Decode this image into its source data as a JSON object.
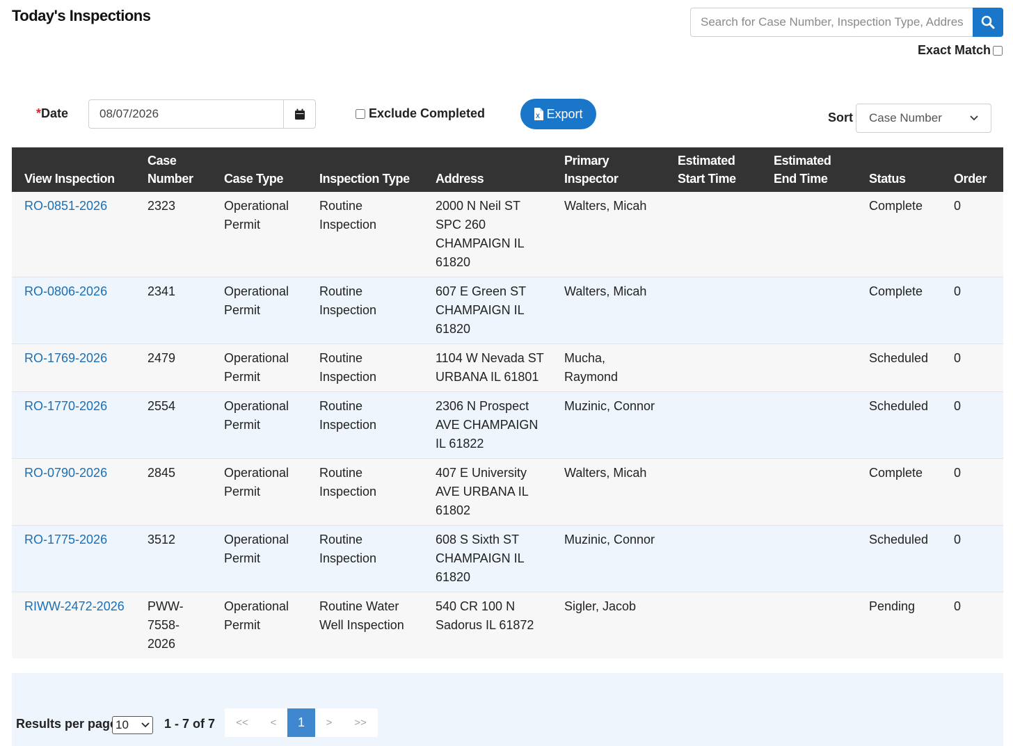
{
  "header": {
    "title": "Today's Inspections",
    "search_placeholder": "Search for Case Number, Inspection Type, Address",
    "exact_match_label": "Exact Match"
  },
  "filters": {
    "date_required_mark": "*",
    "date_label": "Date",
    "date_value": "08/07/2026",
    "exclude_completed_label": "Exclude Completed",
    "export_label": "Export",
    "sort_label": "Sort",
    "sort_value": "Case Number"
  },
  "table": {
    "columns": [
      "View Inspection",
      "Case Number",
      "Case Type",
      "Inspection Type",
      "Address",
      "Primary Inspector",
      "Estimated Start Time",
      "Estimated End Time",
      "Status",
      "Order"
    ],
    "rows": [
      {
        "view": "RO-0851-2026",
        "case_number": "2323",
        "case_type": "Operational Permit",
        "inspection_type": "Routine Inspection",
        "address": "2000 N Neil ST SPC 260 CHAMPAIGN IL 61820",
        "inspector": "Walters, Micah",
        "start": "",
        "end": "",
        "status": "Complete",
        "order": "0"
      },
      {
        "view": "RO-0806-2026",
        "case_number": "2341",
        "case_type": "Operational Permit",
        "inspection_type": "Routine Inspection",
        "address": "607 E Green ST CHAMPAIGN IL 61820",
        "inspector": "Walters, Micah",
        "start": "",
        "end": "",
        "status": "Complete",
        "order": "0"
      },
      {
        "view": "RO-1769-2026",
        "case_number": "2479",
        "case_type": "Operational Permit",
        "inspection_type": "Routine Inspection",
        "address": "1104 W Nevada ST URBANA IL 61801",
        "inspector": "Mucha, Raymond",
        "start": "",
        "end": "",
        "status": "Scheduled",
        "order": "0"
      },
      {
        "view": "RO-1770-2026",
        "case_number": "2554",
        "case_type": "Operational Permit",
        "inspection_type": "Routine Inspection",
        "address": "2306 N Prospect AVE CHAMPAIGN IL 61822",
        "inspector": "Muzinic, Connor",
        "start": "",
        "end": "",
        "status": "Scheduled",
        "order": "0"
      },
      {
        "view": "RO-0790-2026",
        "case_number": "2845",
        "case_type": "Operational Permit",
        "inspection_type": "Routine Inspection",
        "address": "407 E University AVE URBANA IL 61802",
        "inspector": "Walters, Micah",
        "start": "",
        "end": "",
        "status": "Complete",
        "order": "0"
      },
      {
        "view": "RO-1775-2026",
        "case_number": "3512",
        "case_type": "Operational Permit",
        "inspection_type": "Routine Inspection",
        "address": "608 S Sixth ST CHAMPAIGN IL 61820",
        "inspector": "Muzinic, Connor",
        "start": "",
        "end": "",
        "status": "Scheduled",
        "order": "0"
      },
      {
        "view": "RIWW-2472-2026",
        "case_number": "PWW-7558-2026",
        "case_type": "Operational Permit",
        "inspection_type": "Routine Water Well Inspection",
        "address": "540 CR 100 N Sadorus IL 61872",
        "inspector": "Sigler, Jacob",
        "start": "",
        "end": "",
        "status": "Pending",
        "order": "0"
      }
    ]
  },
  "footer": {
    "results_per_page_label": "Results per page",
    "results_per_page_value": "10",
    "range_text": "1 - 7 of 7",
    "pager": {
      "first": "<<",
      "prev": "<",
      "current": "1",
      "next": ">",
      "last": ">>"
    }
  },
  "colors": {
    "accent": "#1a76c9",
    "header_bg": "#333333",
    "link": "#1a6fb7",
    "required": "#d9262a"
  },
  "icons": [
    "search-icon",
    "calendar-icon",
    "excel-icon",
    "chevron-down-icon"
  ]
}
